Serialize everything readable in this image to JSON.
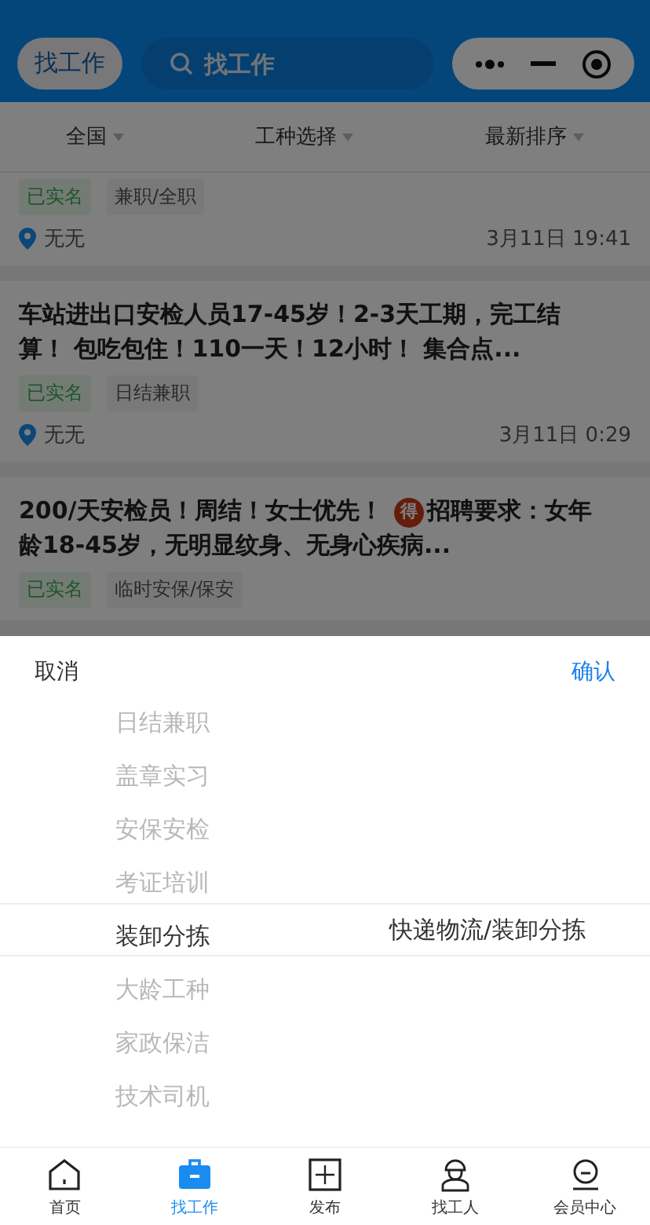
{
  "header": {
    "chip": "找工作",
    "search": {
      "placeholder": "找工作"
    }
  },
  "filters": [
    {
      "label": "全国"
    },
    {
      "label": "工种选择"
    },
    {
      "label": "最新排序"
    }
  ],
  "jobs": [
    {
      "tags": [
        {
          "text": "已实名",
          "kind": "verified"
        },
        {
          "text": "兼职/全职",
          "kind": "type"
        }
      ],
      "location": "无无",
      "time": "3月11日 19:41"
    },
    {
      "title": [
        {
          "kind": "text",
          "text": "车站进出口安检人员17-45岁！2-3天工期，完工结算！ 包吃包住！110一天！12小时！ 集合点..."
        }
      ],
      "tags": [
        {
          "text": "已实名",
          "kind": "verified"
        },
        {
          "text": "日结兼职",
          "kind": "type"
        }
      ],
      "location": "无无",
      "time": "3月11日 0:29"
    },
    {
      "title": [
        {
          "kind": "text",
          "text": "200/天安检员！周结！女士优先！ "
        },
        {
          "kind": "badge",
          "text": "得"
        },
        {
          "kind": "text",
          "text": "招聘要求：女年龄18-45岁，无明显纹身、无身心疾病..."
        }
      ],
      "tags": [
        {
          "text": "已实名",
          "kind": "verified"
        },
        {
          "text": "临时安保/保安",
          "kind": "type"
        }
      ]
    }
  ],
  "picker": {
    "cancel": "取消",
    "confirm": "确认",
    "column_1": [
      {
        "label": "日结兼职",
        "selected": false
      },
      {
        "label": "盖章实习",
        "selected": false
      },
      {
        "label": "安保安检",
        "selected": false
      },
      {
        "label": "考证培训",
        "selected": false
      },
      {
        "label": "装卸分拣",
        "selected": true
      },
      {
        "label": "大龄工种",
        "selected": false
      },
      {
        "label": "家政保洁",
        "selected": false
      },
      {
        "label": "技术司机",
        "selected": false
      }
    ],
    "column_2": [
      {
        "label": "快递物流/装卸分拣",
        "selected": true
      }
    ]
  },
  "tabbar": [
    {
      "label": "首页",
      "selected": false
    },
    {
      "label": "找工作",
      "selected": true
    },
    {
      "label": "发布",
      "selected": false
    },
    {
      "label": "找工人",
      "selected": false
    },
    {
      "label": "会员中心",
      "selected": false
    }
  ]
}
